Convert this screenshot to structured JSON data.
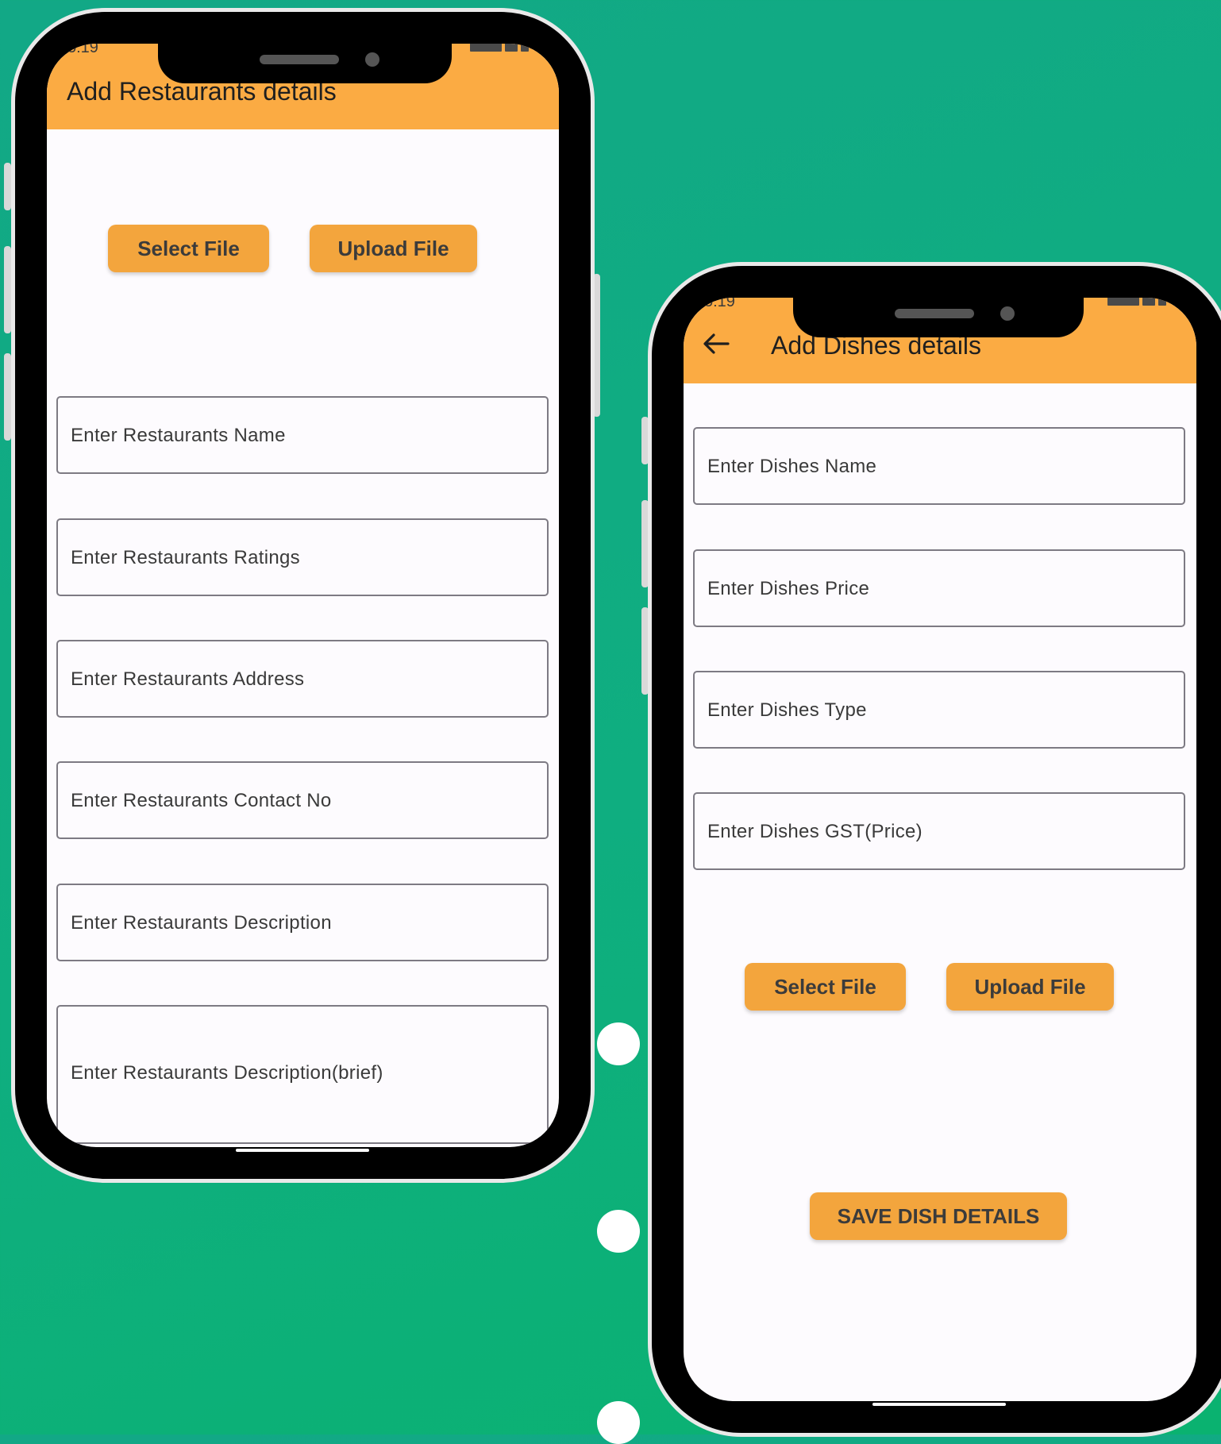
{
  "restaurant_screen": {
    "status_time": "5:19",
    "title": "Add Restaurants details",
    "select_file_label": "Select File",
    "upload_file_label": "Upload File",
    "fields": [
      {
        "placeholder": "Enter Restaurants Name"
      },
      {
        "placeholder": "Enter Restaurants Ratings"
      },
      {
        "placeholder": "Enter Restaurants Address"
      },
      {
        "placeholder": "Enter Restaurants Contact No"
      },
      {
        "placeholder": "Enter Restaurants Description"
      },
      {
        "placeholder": "Enter Restaurants Description(brief)"
      }
    ]
  },
  "dishes_screen": {
    "status_time": "5:19",
    "back_icon": "arrow-left-icon",
    "title": "Add Dishes details",
    "fields": [
      {
        "placeholder": "Enter Dishes Name"
      },
      {
        "placeholder": "Enter Dishes Price"
      },
      {
        "placeholder": "Enter Dishes Type"
      },
      {
        "placeholder": "Enter Dishes GST(Price)"
      }
    ],
    "select_file_label": "Select File",
    "upload_file_label": "Upload File",
    "save_label": "SAVE DISH DETAILS"
  },
  "colors": {
    "background": "#0fae80",
    "appbar": "#fbab43",
    "button": "#f3a53d",
    "screen": "#fdfbfe"
  }
}
